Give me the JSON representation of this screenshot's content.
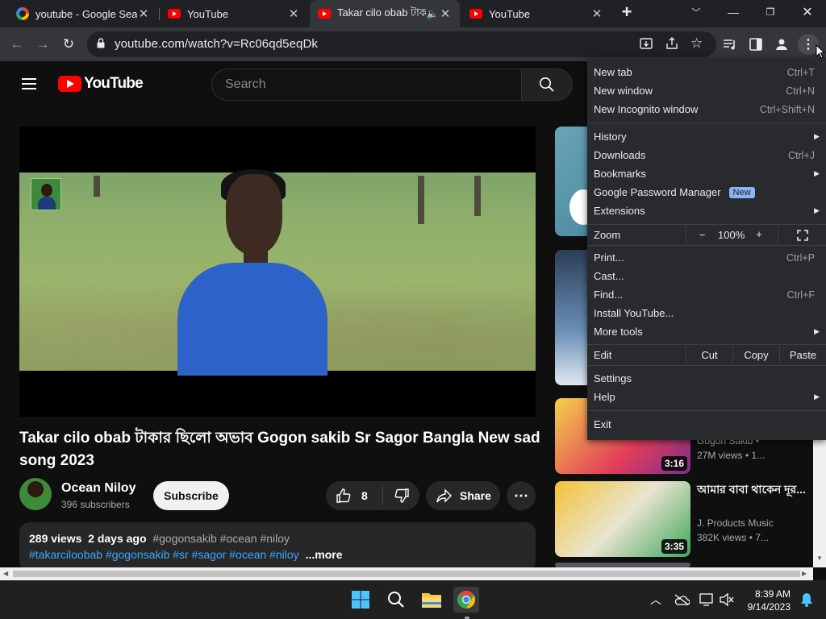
{
  "browser": {
    "tabs": [
      {
        "title": "youtube - Google Search",
        "favicon": "google-g-icon",
        "active": false
      },
      {
        "title": "YouTube",
        "favicon": "youtube-icon",
        "active": false
      },
      {
        "title": "Takar cilo obab টাকা",
        "favicon": "youtube-icon",
        "active": true,
        "audio": true
      },
      {
        "title": "YouTube",
        "favicon": "youtube-icon",
        "active": false
      }
    ],
    "new_tab_label": "+",
    "url": "youtube.com/watch?v=Rc06qd5eqDk"
  },
  "youtube": {
    "logo_text": "YouTube",
    "search_placeholder": "Search",
    "video_title": "Takar cilo obab টাকার ছিলো অভাব Gogon sakib Sr Sagor Bangla New sad song 2023",
    "channel_name": "Ocean Niloy",
    "subscribers": "396 subscribers",
    "subscribe_label": "Subscribe",
    "likes": "8",
    "share_label": "Share",
    "description": {
      "views": "289 views",
      "age": "2 days ago",
      "hashtags_inline": "#gogonsakib #ocean #niloy",
      "hashtags_line2": "#takarciloobab #gogonsakib #sr #sagor #ocean #niloy",
      "more_label": "...more"
    },
    "related": [
      {
        "duration": "",
        "channel": "",
        "meta": ""
      },
      {
        "duration": "3:16",
        "channel": "Gogon Sakib •",
        "meta": "27M views • 1..."
      },
      {
        "duration": "3:35",
        "title": "আমার বাবা থাকেন দূর...",
        "channel": "J. Products Music",
        "meta": "382K views • 7..."
      }
    ]
  },
  "menu": {
    "items": [
      {
        "label": "New tab",
        "shortcut": "Ctrl+T"
      },
      {
        "label": "New window",
        "shortcut": "Ctrl+N"
      },
      {
        "label": "New Incognito window",
        "shortcut": "Ctrl+Shift+N"
      },
      {
        "label": "History",
        "shortcut": ""
      },
      {
        "label": "Downloads",
        "shortcut": "Ctrl+J"
      },
      {
        "label": "Bookmarks",
        "shortcut": ""
      },
      {
        "label": "Google Password Manager",
        "badge": "New"
      },
      {
        "label": "Extensions",
        "shortcut": ""
      },
      {
        "label": "Zoom",
        "zoom_minus": "−",
        "zoom_value": "100%",
        "zoom_plus": "+"
      },
      {
        "label": "Print...",
        "shortcut": "Ctrl+P"
      },
      {
        "label": "Cast...",
        "shortcut": ""
      },
      {
        "label": "Find...",
        "shortcut": "Ctrl+F"
      },
      {
        "label": "Install YouTube...",
        "shortcut": ""
      },
      {
        "label": "More tools",
        "shortcut": ""
      },
      {
        "label": "Edit",
        "cut": "Cut",
        "copy": "Copy",
        "paste": "Paste"
      },
      {
        "label": "Settings",
        "shortcut": ""
      },
      {
        "label": "Help",
        "shortcut": ""
      },
      {
        "label": "Exit",
        "shortcut": ""
      }
    ]
  },
  "taskbar": {
    "time": "8:39 AM",
    "date": "9/14/2023"
  },
  "colors": {
    "youtube_red": "#ff0000",
    "link_blue": "#3ea6ff",
    "menu_bg": "#292a2d",
    "new_badge": "#8ab4f8"
  }
}
